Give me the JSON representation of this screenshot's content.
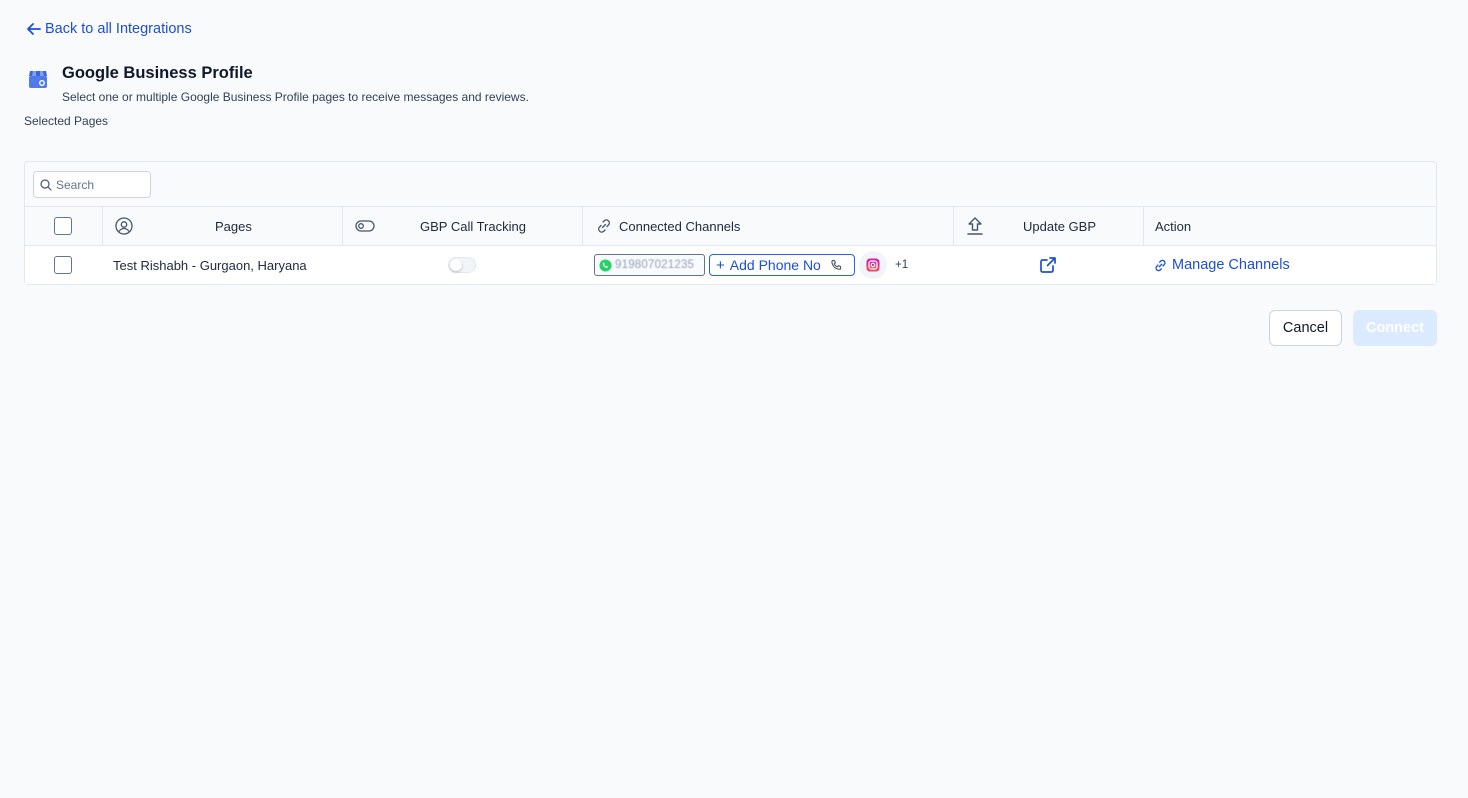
{
  "nav": {
    "back_label": "Back to all Integrations"
  },
  "header": {
    "title": "Google Business Profile",
    "subtitle": "Select one or multiple Google Business Profile pages to receive messages and reviews."
  },
  "section_label": "Selected Pages",
  "search": {
    "placeholder": "Search",
    "value": ""
  },
  "table": {
    "columns": {
      "pages": "Pages",
      "call_tracking": "GBP Call Tracking",
      "connected_channels": "Connected Channels",
      "update_gbp": "Update GBP",
      "action": "Action"
    },
    "rows": [
      {
        "page_name": "Test Rishabh - Gurgaon, Haryana",
        "call_tracking_enabled": false,
        "whatsapp_number": "919807021235",
        "add_phone_label": "Add Phone No",
        "extra_channels": "+1",
        "action_label": "Manage Channels"
      }
    ]
  },
  "buttons": {
    "cancel": "Cancel",
    "connect": "Connect"
  },
  "colors": {
    "accent": "#1d4ed8",
    "background": "#f8fafc",
    "connect_disabled": "#dbeafe",
    "whatsapp": "#25d366"
  },
  "icons": {
    "back": "arrow-left-icon",
    "logo": "google-business-profile-icon",
    "search": "search-icon",
    "pages_col": "user-circle-icon",
    "tracking_col": "toggle-icon",
    "channels_col": "link-icon",
    "update_col": "upload-icon",
    "update_row": "external-link-icon",
    "manage": "link-icon",
    "whatsapp": "whatsapp-icon",
    "phone": "phone-icon",
    "instagram": "instagram-icon"
  }
}
